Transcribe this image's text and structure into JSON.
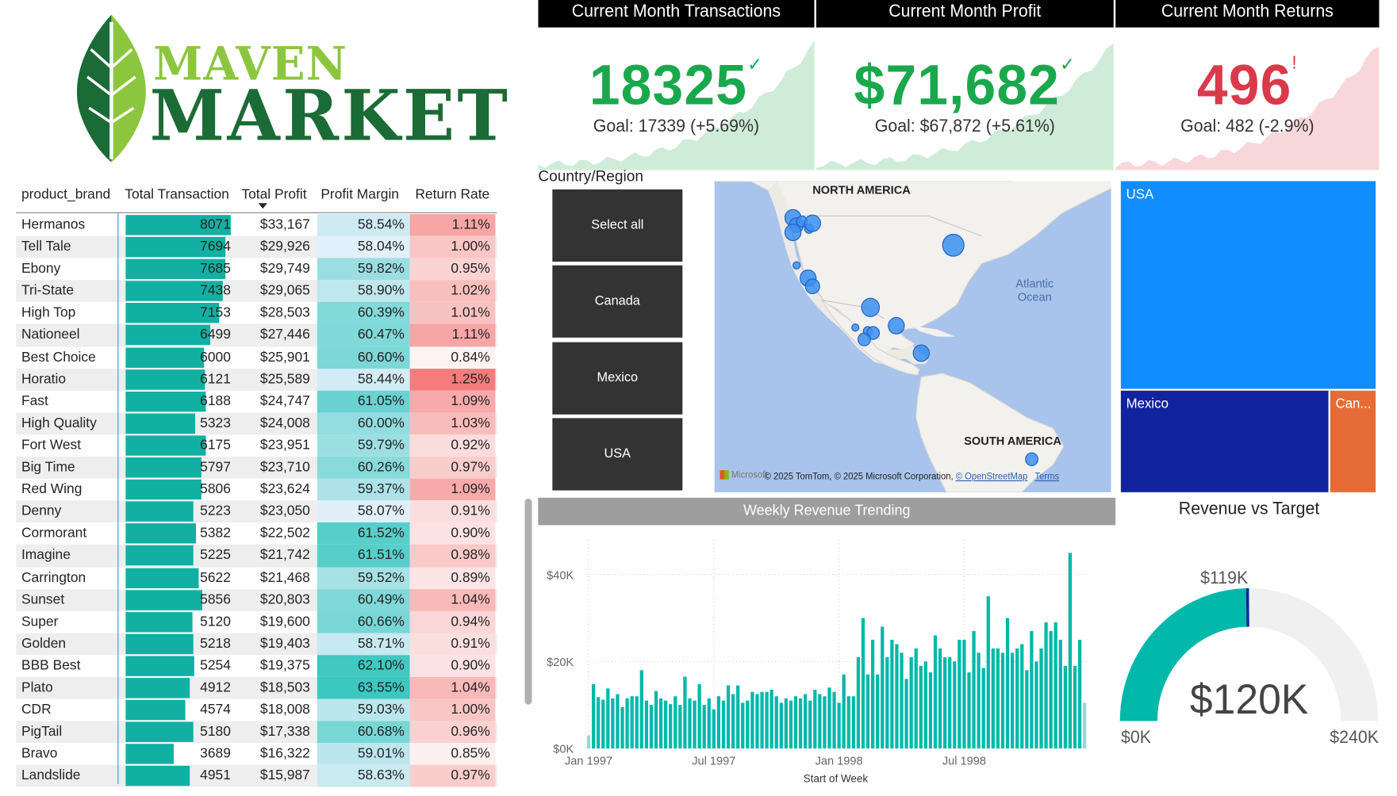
{
  "logo": {
    "word1": "MAVEN",
    "word2": "MARKET"
  },
  "table": {
    "headers": {
      "brand": "product_brand",
      "transactions": "Total Transaction",
      "profit": "Total Profit",
      "margin": "Profit Margin",
      "return_rate": "Return Rate"
    },
    "max_transactions": 8071,
    "rows": [
      {
        "brand": "Hermanos",
        "transactions": "8071",
        "tx": 8071,
        "profit": "$33,167",
        "margin": "58.54%",
        "m": 58.54,
        "return_rate": "1.11%",
        "r": 1.11
      },
      {
        "brand": "Tell Tale",
        "transactions": "7694",
        "tx": 7694,
        "profit": "$29,926",
        "margin": "58.04%",
        "m": 58.04,
        "return_rate": "1.00%",
        "r": 1.0
      },
      {
        "brand": "Ebony",
        "transactions": "7685",
        "tx": 7685,
        "profit": "$29,749",
        "margin": "59.82%",
        "m": 59.82,
        "return_rate": "0.95%",
        "r": 0.95
      },
      {
        "brand": "Tri-State",
        "transactions": "7438",
        "tx": 7438,
        "profit": "$29,065",
        "margin": "58.90%",
        "m": 58.9,
        "return_rate": "1.02%",
        "r": 1.02
      },
      {
        "brand": "High Top",
        "transactions": "7153",
        "tx": 7153,
        "profit": "$28,503",
        "margin": "60.39%",
        "m": 60.39,
        "return_rate": "1.01%",
        "r": 1.01
      },
      {
        "brand": "Nationeel",
        "transactions": "6499",
        "tx": 6499,
        "profit": "$27,446",
        "margin": "60.47%",
        "m": 60.47,
        "return_rate": "1.11%",
        "r": 1.11
      },
      {
        "brand": "Best Choice",
        "transactions": "6000",
        "tx": 6000,
        "profit": "$25,901",
        "margin": "60.60%",
        "m": 60.6,
        "return_rate": "0.84%",
        "r": 0.84
      },
      {
        "brand": "Horatio",
        "transactions": "6121",
        "tx": 6121,
        "profit": "$25,589",
        "margin": "58.44%",
        "m": 58.44,
        "return_rate": "1.25%",
        "r": 1.25
      },
      {
        "brand": "Fast",
        "transactions": "6188",
        "tx": 6188,
        "profit": "$24,747",
        "margin": "61.05%",
        "m": 61.05,
        "return_rate": "1.09%",
        "r": 1.09
      },
      {
        "brand": "High Quality",
        "transactions": "5323",
        "tx": 5323,
        "profit": "$24,008",
        "margin": "60.00%",
        "m": 60.0,
        "return_rate": "1.03%",
        "r": 1.03
      },
      {
        "brand": "Fort West",
        "transactions": "6175",
        "tx": 6175,
        "profit": "$23,951",
        "margin": "59.79%",
        "m": 59.79,
        "return_rate": "0.92%",
        "r": 0.92
      },
      {
        "brand": "Big Time",
        "transactions": "5797",
        "tx": 5797,
        "profit": "$23,710",
        "margin": "60.26%",
        "m": 60.26,
        "return_rate": "0.97%",
        "r": 0.97
      },
      {
        "brand": "Red Wing",
        "transactions": "5806",
        "tx": 5806,
        "profit": "$23,624",
        "margin": "59.37%",
        "m": 59.37,
        "return_rate": "1.09%",
        "r": 1.09
      },
      {
        "brand": "Denny",
        "transactions": "5223",
        "tx": 5223,
        "profit": "$23,050",
        "margin": "58.07%",
        "m": 58.07,
        "return_rate": "0.91%",
        "r": 0.91
      },
      {
        "brand": "Cormorant",
        "transactions": "5382",
        "tx": 5382,
        "profit": "$22,502",
        "margin": "61.52%",
        "m": 61.52,
        "return_rate": "0.90%",
        "r": 0.9
      },
      {
        "brand": "Imagine",
        "transactions": "5225",
        "tx": 5225,
        "profit": "$21,742",
        "margin": "61.51%",
        "m": 61.51,
        "return_rate": "0.98%",
        "r": 0.98
      },
      {
        "brand": "Carrington",
        "transactions": "5622",
        "tx": 5622,
        "profit": "$21,468",
        "margin": "59.52%",
        "m": 59.52,
        "return_rate": "0.89%",
        "r": 0.89
      },
      {
        "brand": "Sunset",
        "transactions": "5856",
        "tx": 5856,
        "profit": "$20,803",
        "margin": "60.49%",
        "m": 60.49,
        "return_rate": "1.04%",
        "r": 1.04
      },
      {
        "brand": "Super",
        "transactions": "5120",
        "tx": 5120,
        "profit": "$19,600",
        "margin": "60.66%",
        "m": 60.66,
        "return_rate": "0.94%",
        "r": 0.94
      },
      {
        "brand": "Golden",
        "transactions": "5218",
        "tx": 5218,
        "profit": "$19,403",
        "margin": "58.71%",
        "m": 58.71,
        "return_rate": "0.91%",
        "r": 0.91
      },
      {
        "brand": "BBB Best",
        "transactions": "5254",
        "tx": 5254,
        "profit": "$19,375",
        "margin": "62.10%",
        "m": 62.1,
        "return_rate": "0.90%",
        "r": 0.9
      },
      {
        "brand": "Plato",
        "transactions": "4912",
        "tx": 4912,
        "profit": "$18,503",
        "margin": "63.55%",
        "m": 63.55,
        "return_rate": "1.04%",
        "r": 1.04
      },
      {
        "brand": "CDR",
        "transactions": "4574",
        "tx": 4574,
        "profit": "$18,008",
        "margin": "59.03%",
        "m": 59.03,
        "return_rate": "1.00%",
        "r": 1.0
      },
      {
        "brand": "PigTail",
        "transactions": "5180",
        "tx": 5180,
        "profit": "$17,338",
        "margin": "60.68%",
        "m": 60.68,
        "return_rate": "0.96%",
        "r": 0.96
      },
      {
        "brand": "Bravo",
        "transactions": "3689",
        "tx": 3689,
        "profit": "$16,322",
        "margin": "59.01%",
        "m": 59.01,
        "return_rate": "0.85%",
        "r": 0.85
      },
      {
        "brand": "Landslide",
        "transactions": "4951",
        "tx": 4951,
        "profit": "$15,987",
        "margin": "58.63%",
        "m": 58.63,
        "return_rate": "0.97%",
        "r": 0.97
      }
    ],
    "colors": {
      "bar": "#11b0a2",
      "margin_high": "#3cc7c0",
      "margin_low": "#e3f0fb",
      "return_high": "#f47c7c",
      "return_low": "#fdf3f3"
    }
  },
  "kpis": [
    {
      "title": "Current Month Transactions",
      "value": "18325",
      "mark": "✓",
      "goal": "Goal: 17339 (+5.69%)",
      "color": "#1aa84c",
      "fill": "#cfecd8"
    },
    {
      "title": "Current Month Profit",
      "value": "$71,682",
      "mark": "✓",
      "goal": "Goal: $67,872 (+5.61%)",
      "color": "#1aa84c",
      "fill": "#cfecd8"
    },
    {
      "title": "Current Month Returns",
      "value": "496",
      "mark": "!",
      "goal": "Goal: 482 (-2.9%)",
      "color": "#d93a4b",
      "fill": "#f8d7da"
    }
  ],
  "slicer": {
    "title": "Country/Region",
    "options": [
      "Select all",
      "Canada",
      "Mexico",
      "USA"
    ]
  },
  "map": {
    "labels": {
      "north_america": "NORTH AMERICA",
      "south_america": "SOUTH AMERICA",
      "ocean_line1": "Atlantic",
      "ocean_line2": "Ocean"
    },
    "copyright": "© 2025 TomTom, © 2025 Microsoft Corporation,",
    "osm_link": "© OpenStreetMap",
    "terms_link": "Terms",
    "brand": "Microsoft"
  },
  "treemap": {
    "cells": [
      {
        "label": "USA",
        "color": "#118dff"
      },
      {
        "label": "Mexico",
        "color": "#12239e"
      },
      {
        "label": "Can...",
        "color": "#e66c37"
      }
    ]
  },
  "weekly": {
    "title": "Weekly Revenue Trending",
    "xlabel": "Start of Week",
    "x_ticks": [
      "Jan 1997",
      "Jul 1997",
      "Jan 1998",
      "Jul 1998"
    ],
    "y_ticks": [
      "$0K",
      "$20K",
      "$40K"
    ]
  },
  "gauge": {
    "title": "Revenue vs Target",
    "value_label": "$120K",
    "target_label": "$119K",
    "min_label": "$0K",
    "max_label": "$240K",
    "color_fill": "#01b8aa",
    "color_track": "#f0f0f0",
    "color_target": "#12239e"
  },
  "chart_data": {
    "type": "bar",
    "title": "Weekly Revenue Trending",
    "xlabel": "Start of Week",
    "ylabel": "",
    "ylim": [
      0,
      48000
    ],
    "x_start": "Jan 1997",
    "x_end": "Dec 1998",
    "values": [
      3000,
      14800,
      11800,
      11200,
      13800,
      11500,
      12500,
      9500,
      11500,
      12000,
      12000,
      18000,
      11000,
      10000,
      13200,
      11500,
      11000,
      10200,
      12000,
      10000,
      16500,
      11500,
      11000,
      14800,
      10000,
      11500,
      9000,
      12000,
      11000,
      14500,
      12500,
      14500,
      10500,
      11000,
      13000,
      12500,
      13000,
      13000,
      13500,
      12000,
      10500,
      11500,
      11000,
      12000,
      11500,
      12500,
      11000,
      13500,
      12500,
      12000,
      14000,
      13000,
      10500,
      17000,
      12000,
      12000,
      21000,
      30000,
      17000,
      25000,
      17000,
      28000,
      21000,
      25000,
      24000,
      22000,
      16000,
      21000,
      23000,
      19000,
      20000,
      17500,
      26000,
      23000,
      21000,
      21000,
      20000,
      25000,
      25000,
      17500,
      27000,
      22000,
      18500,
      35000,
      23000,
      23000,
      22000,
      30000,
      22000,
      23000,
      24000,
      18000,
      27000,
      20000,
      23000,
      29000,
      27000,
      29000,
      25000,
      19000,
      45000,
      19000,
      25000,
      10500
    ]
  }
}
